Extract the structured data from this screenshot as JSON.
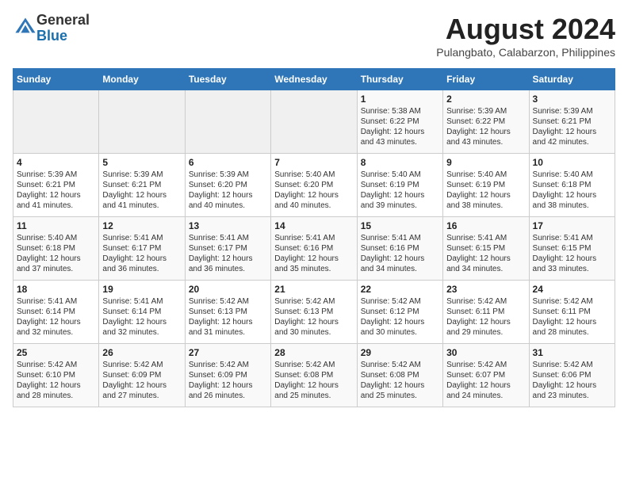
{
  "logo": {
    "line1": "General",
    "line2": "Blue"
  },
  "title": {
    "month_year": "August 2024",
    "location": "Pulangbato, Calabarzon, Philippines"
  },
  "weekdays": [
    "Sunday",
    "Monday",
    "Tuesday",
    "Wednesday",
    "Thursday",
    "Friday",
    "Saturday"
  ],
  "weeks": [
    [
      {
        "day": "",
        "info": ""
      },
      {
        "day": "",
        "info": ""
      },
      {
        "day": "",
        "info": ""
      },
      {
        "day": "",
        "info": ""
      },
      {
        "day": "1",
        "info": "Sunrise: 5:38 AM\nSunset: 6:22 PM\nDaylight: 12 hours\nand 43 minutes."
      },
      {
        "day": "2",
        "info": "Sunrise: 5:39 AM\nSunset: 6:22 PM\nDaylight: 12 hours\nand 43 minutes."
      },
      {
        "day": "3",
        "info": "Sunrise: 5:39 AM\nSunset: 6:21 PM\nDaylight: 12 hours\nand 42 minutes."
      }
    ],
    [
      {
        "day": "4",
        "info": "Sunrise: 5:39 AM\nSunset: 6:21 PM\nDaylight: 12 hours\nand 41 minutes."
      },
      {
        "day": "5",
        "info": "Sunrise: 5:39 AM\nSunset: 6:21 PM\nDaylight: 12 hours\nand 41 minutes."
      },
      {
        "day": "6",
        "info": "Sunrise: 5:39 AM\nSunset: 6:20 PM\nDaylight: 12 hours\nand 40 minutes."
      },
      {
        "day": "7",
        "info": "Sunrise: 5:40 AM\nSunset: 6:20 PM\nDaylight: 12 hours\nand 40 minutes."
      },
      {
        "day": "8",
        "info": "Sunrise: 5:40 AM\nSunset: 6:19 PM\nDaylight: 12 hours\nand 39 minutes."
      },
      {
        "day": "9",
        "info": "Sunrise: 5:40 AM\nSunset: 6:19 PM\nDaylight: 12 hours\nand 38 minutes."
      },
      {
        "day": "10",
        "info": "Sunrise: 5:40 AM\nSunset: 6:18 PM\nDaylight: 12 hours\nand 38 minutes."
      }
    ],
    [
      {
        "day": "11",
        "info": "Sunrise: 5:40 AM\nSunset: 6:18 PM\nDaylight: 12 hours\nand 37 minutes."
      },
      {
        "day": "12",
        "info": "Sunrise: 5:41 AM\nSunset: 6:17 PM\nDaylight: 12 hours\nand 36 minutes."
      },
      {
        "day": "13",
        "info": "Sunrise: 5:41 AM\nSunset: 6:17 PM\nDaylight: 12 hours\nand 36 minutes."
      },
      {
        "day": "14",
        "info": "Sunrise: 5:41 AM\nSunset: 6:16 PM\nDaylight: 12 hours\nand 35 minutes."
      },
      {
        "day": "15",
        "info": "Sunrise: 5:41 AM\nSunset: 6:16 PM\nDaylight: 12 hours\nand 34 minutes."
      },
      {
        "day": "16",
        "info": "Sunrise: 5:41 AM\nSunset: 6:15 PM\nDaylight: 12 hours\nand 34 minutes."
      },
      {
        "day": "17",
        "info": "Sunrise: 5:41 AM\nSunset: 6:15 PM\nDaylight: 12 hours\nand 33 minutes."
      }
    ],
    [
      {
        "day": "18",
        "info": "Sunrise: 5:41 AM\nSunset: 6:14 PM\nDaylight: 12 hours\nand 32 minutes."
      },
      {
        "day": "19",
        "info": "Sunrise: 5:41 AM\nSunset: 6:14 PM\nDaylight: 12 hours\nand 32 minutes."
      },
      {
        "day": "20",
        "info": "Sunrise: 5:42 AM\nSunset: 6:13 PM\nDaylight: 12 hours\nand 31 minutes."
      },
      {
        "day": "21",
        "info": "Sunrise: 5:42 AM\nSunset: 6:13 PM\nDaylight: 12 hours\nand 30 minutes."
      },
      {
        "day": "22",
        "info": "Sunrise: 5:42 AM\nSunset: 6:12 PM\nDaylight: 12 hours\nand 30 minutes."
      },
      {
        "day": "23",
        "info": "Sunrise: 5:42 AM\nSunset: 6:11 PM\nDaylight: 12 hours\nand 29 minutes."
      },
      {
        "day": "24",
        "info": "Sunrise: 5:42 AM\nSunset: 6:11 PM\nDaylight: 12 hours\nand 28 minutes."
      }
    ],
    [
      {
        "day": "25",
        "info": "Sunrise: 5:42 AM\nSunset: 6:10 PM\nDaylight: 12 hours\nand 28 minutes."
      },
      {
        "day": "26",
        "info": "Sunrise: 5:42 AM\nSunset: 6:09 PM\nDaylight: 12 hours\nand 27 minutes."
      },
      {
        "day": "27",
        "info": "Sunrise: 5:42 AM\nSunset: 6:09 PM\nDaylight: 12 hours\nand 26 minutes."
      },
      {
        "day": "28",
        "info": "Sunrise: 5:42 AM\nSunset: 6:08 PM\nDaylight: 12 hours\nand 25 minutes."
      },
      {
        "day": "29",
        "info": "Sunrise: 5:42 AM\nSunset: 6:08 PM\nDaylight: 12 hours\nand 25 minutes."
      },
      {
        "day": "30",
        "info": "Sunrise: 5:42 AM\nSunset: 6:07 PM\nDaylight: 12 hours\nand 24 minutes."
      },
      {
        "day": "31",
        "info": "Sunrise: 5:42 AM\nSunset: 6:06 PM\nDaylight: 12 hours\nand 23 minutes."
      }
    ]
  ]
}
